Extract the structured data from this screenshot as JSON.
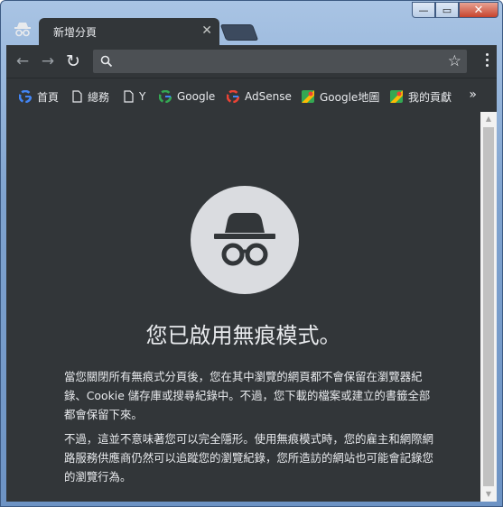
{
  "tab": {
    "title": "新增分頁",
    "close": "✕"
  },
  "window_controls": {
    "minimize": "—",
    "maximize": "▭",
    "close": "✕"
  },
  "toolbar": {
    "back": "←",
    "forward": "→",
    "reload": "↻",
    "omnibox_value": "",
    "star": "☆"
  },
  "bookmarks": {
    "items": [
      {
        "label": "首頁",
        "icon": "google-icon"
      },
      {
        "label": "總務",
        "icon": "document-icon"
      },
      {
        "label": "Y",
        "icon": "document-icon"
      },
      {
        "label": "Google",
        "icon": "google-icon"
      },
      {
        "label": "AdSense",
        "icon": "google-icon"
      },
      {
        "label": "Google地圖",
        "icon": "maps-icon"
      },
      {
        "label": "我的貢獻",
        "icon": "maps-icon"
      }
    ],
    "more": "»"
  },
  "incognito": {
    "title": "您已啟用無痕模式。",
    "paragraph1": "當您關閉所有無痕式分頁後，您在其中瀏覽的網頁都不會保留在瀏覽器紀錄、Cookie 儲存庫或搜尋紀錄中。不過，您下載的檔案或建立的書籤全部都會保留下來。",
    "paragraph2": "不過，這並不意味著您可以完全隱形。使用無痕模式時，您的雇主和網際網路服務供應商仍然可以追蹤您的瀏覽紀錄，您所造訪的網站也可能會記錄您的瀏覽行為。"
  },
  "scrollbar": {
    "up": "▲",
    "down": "▼"
  },
  "colors": {
    "chrome_dark": "#323639",
    "hero_circle": "#dadce0",
    "frame": "#7fa3cf"
  }
}
